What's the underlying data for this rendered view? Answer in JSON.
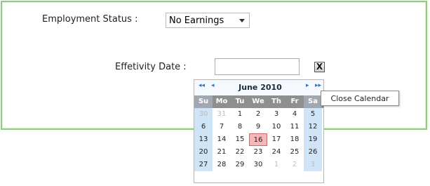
{
  "form": {
    "employment_status_label": "Employment Status :",
    "employment_status_value": "No Earnings",
    "effectivity_date_label": "Effetivity Date :",
    "effectivity_date_value": ""
  },
  "calendar": {
    "title": "June 2010",
    "nav": {
      "prev_year": "◂◂",
      "prev_month": "◂",
      "next_month": "▸",
      "next_year": "▸▸"
    },
    "days_of_week": [
      "Su",
      "Mo",
      "Tu",
      "We",
      "Th",
      "Fr",
      "Sa"
    ],
    "weeks": [
      [
        {
          "d": "30",
          "other": true
        },
        {
          "d": "31",
          "other": true
        },
        {
          "d": "1"
        },
        {
          "d": "2"
        },
        {
          "d": "3"
        },
        {
          "d": "4"
        },
        {
          "d": "5"
        }
      ],
      [
        {
          "d": "6"
        },
        {
          "d": "7"
        },
        {
          "d": "8"
        },
        {
          "d": "9"
        },
        {
          "d": "10"
        },
        {
          "d": "11"
        },
        {
          "d": "12"
        }
      ],
      [
        {
          "d": "13"
        },
        {
          "d": "14"
        },
        {
          "d": "15"
        },
        {
          "d": "16",
          "today": true
        },
        {
          "d": "17"
        },
        {
          "d": "18"
        },
        {
          "d": "19"
        }
      ],
      [
        {
          "d": "20"
        },
        {
          "d": "21"
        },
        {
          "d": "22"
        },
        {
          "d": "23"
        },
        {
          "d": "24"
        },
        {
          "d": "25"
        },
        {
          "d": "26"
        }
      ],
      [
        {
          "d": "27"
        },
        {
          "d": "28"
        },
        {
          "d": "29"
        },
        {
          "d": "30"
        },
        {
          "d": "1",
          "other": true
        },
        {
          "d": "2",
          "other": true
        },
        {
          "d": "3",
          "other": true
        }
      ]
    ]
  },
  "close_button": {
    "symbol": "X",
    "tooltip": "Close Calendar"
  }
}
